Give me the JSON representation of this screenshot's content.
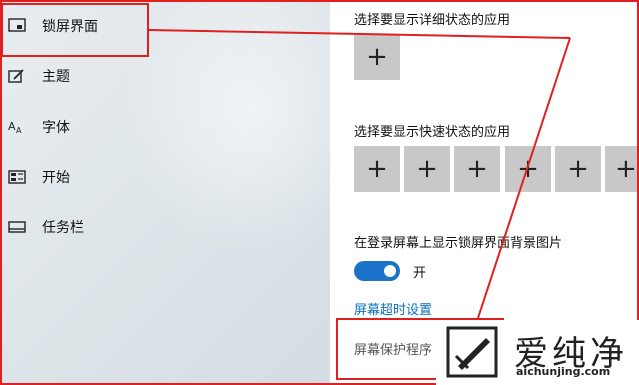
{
  "sidebar": {
    "items": [
      {
        "label": "锁屏界面",
        "icon": "lock-screen-icon"
      },
      {
        "label": "主题",
        "icon": "theme-icon"
      },
      {
        "label": "字体",
        "icon": "font-icon"
      },
      {
        "label": "开始",
        "icon": "start-icon"
      },
      {
        "label": "任务栏",
        "icon": "taskbar-icon"
      }
    ]
  },
  "main": {
    "detail_heading": "选择要显示详细状态的应用",
    "quick_heading": "选择要显示快速状态的应用",
    "plus": "+",
    "background_heading": "在登录屏幕上显示锁屏界面背景图片",
    "toggle_state": "开",
    "toggle_on": true,
    "timeout_link": "屏幕超时设置",
    "screensaver_link": "屏幕保护程序"
  },
  "watermark": {
    "name": "爱纯净",
    "url": "aichunjing.com"
  },
  "colors": {
    "accent": "#1a73c8",
    "annotation": "#e02020",
    "link": "#0a6fc2"
  }
}
